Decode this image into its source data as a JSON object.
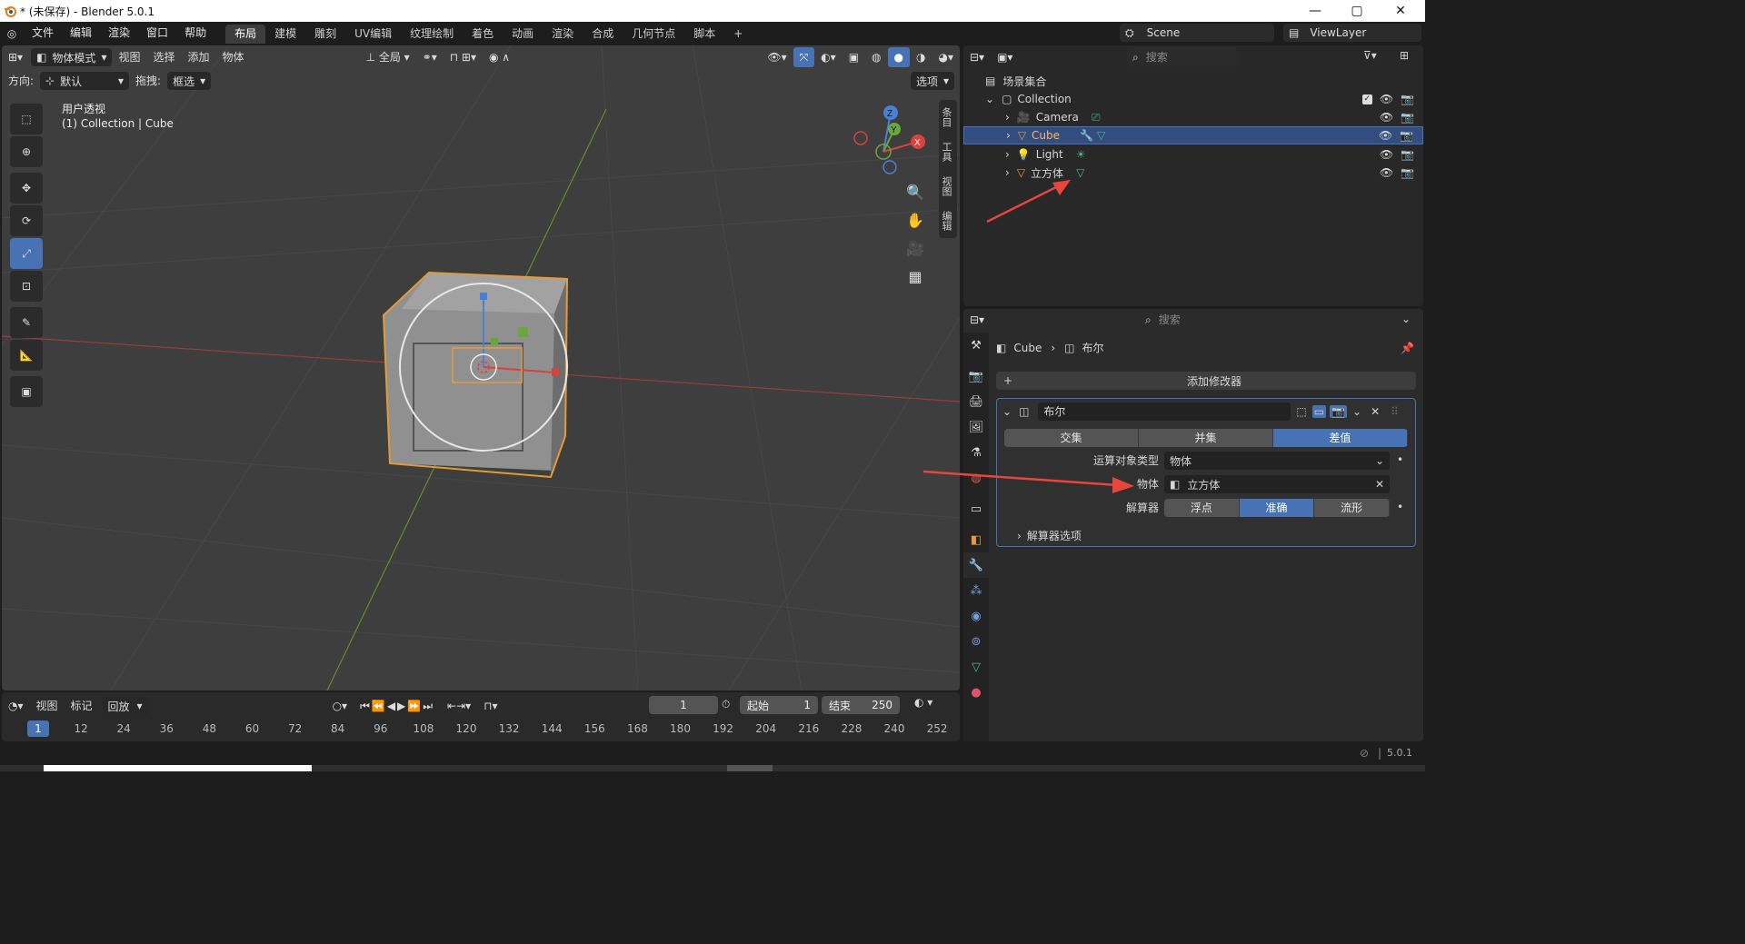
{
  "window": {
    "title": "* (未保存) - Blender 5.0.1",
    "minimize": "—",
    "maximize": "▢",
    "close": "✕"
  },
  "menu": [
    "文件",
    "编辑",
    "渲染",
    "窗口",
    "帮助"
  ],
  "workspaces": [
    "布局",
    "建模",
    "雕刻",
    "UV编辑",
    "纹理绘制",
    "着色",
    "动画",
    "渲染",
    "合成",
    "几何节点",
    "脚本"
  ],
  "workspace_add": "+",
  "scene": {
    "name": "Scene",
    "view_layer": "ViewLayer"
  },
  "viewport": {
    "mode": "物体模式",
    "menus": [
      "视图",
      "选择",
      "添加",
      "物体"
    ],
    "transform_space": "全局",
    "orientation_label": "方向:",
    "orientation_value": "默认",
    "drag_label": "拖拽:",
    "drag_value": "框选",
    "options": "选项",
    "view_name": "用户透视",
    "collection_info": "(1) Collection | Cube",
    "side_tabs": [
      "条目",
      "工具",
      "视图",
      "编辑"
    ],
    "gizmo": {
      "x": "X",
      "y": "Y",
      "z": "Z"
    }
  },
  "timeline": {
    "menus": [
      "视图",
      "标记"
    ],
    "playback": "回放",
    "current_frame": "1",
    "start_label": "起始",
    "start": "1",
    "end_label": "结束",
    "end": "250",
    "ruler": [
      "1",
      "12",
      "24",
      "36",
      "48",
      "60",
      "72",
      "84",
      "96",
      "108",
      "120",
      "132",
      "144",
      "156",
      "168",
      "180",
      "192",
      "204",
      "216",
      "228",
      "240",
      "252"
    ]
  },
  "outliner": {
    "search_placeholder": "搜索",
    "scene_collection": "场景集合",
    "collection": "Collection",
    "items": [
      {
        "name": "Camera",
        "color": "#e0a15a"
      },
      {
        "name": "Cube",
        "color": "#e59a3a",
        "selected": true
      },
      {
        "name": "Light",
        "color": "#e0a15a"
      },
      {
        "name": "立方体",
        "color": "#e59a3a"
      }
    ]
  },
  "properties": {
    "search_placeholder": "搜索",
    "breadcrumb_object": "Cube",
    "breadcrumb_modifier": "布尔",
    "add_modifier": "添加修改器",
    "modifier_name": "布尔",
    "operations": [
      "交集",
      "并集",
      "差值"
    ],
    "active_operation": "差值",
    "operand_type_label": "运算对象类型",
    "operand_type_value": "物体",
    "object_label": "物体",
    "object_value": "立方体",
    "solver_label": "解算器",
    "solvers": [
      "浮点",
      "准确",
      "流形"
    ],
    "active_solver": "准确",
    "solver_options": "解算器选项"
  },
  "status": {
    "version": "5.0.1"
  },
  "colors": {
    "accent": "#4772b3",
    "selection": "#e59a3a",
    "arrow": "#e8453c"
  }
}
